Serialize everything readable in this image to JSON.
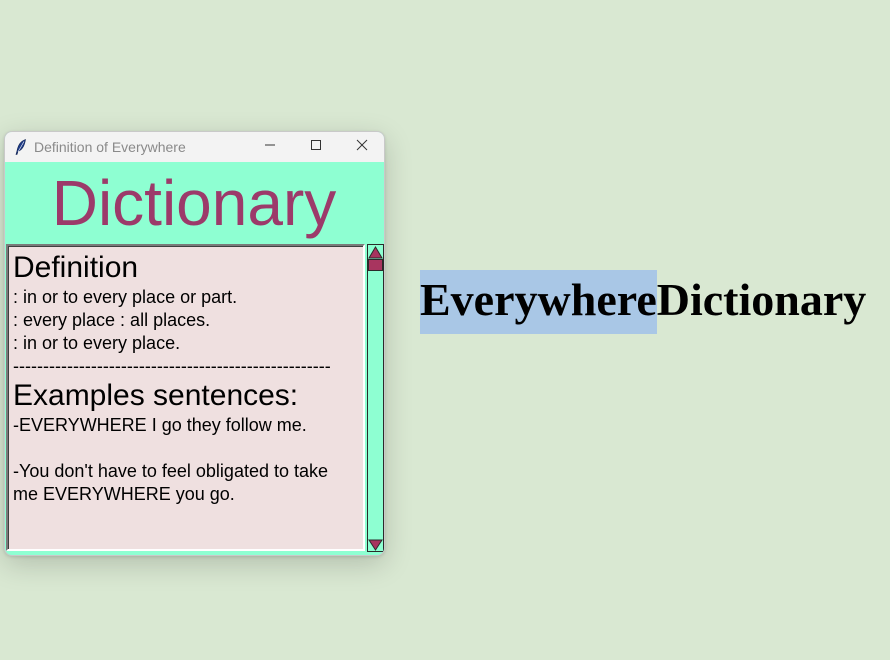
{
  "window": {
    "title": "Definition of Everywhere",
    "icons": {
      "app": "feather-icon",
      "minimize": "minimize-icon",
      "maximize": "maximize-icon",
      "close": "close-icon"
    }
  },
  "app": {
    "heading": "Dictionary",
    "text": {
      "definition_heading": "Definition",
      "definitions": [
        ": in or to every place or part.",
        ": every place : all places.",
        ": in or to every place."
      ],
      "separator": "-----------------------------------------------------",
      "examples_heading": "Examples sentences:",
      "example_1": "-EVERYWHERE I go they follow me.",
      "example_2": "-You don't have to feel obligated to take me EVERYWHERE you go."
    },
    "scrollbar": {
      "up_icon": "scroll-up-arrow-icon",
      "down_icon": "scroll-down-arrow-icon"
    }
  },
  "desktop": {
    "selected_word": "Everywhere",
    "trailing_word": "Dictionary"
  },
  "colors": {
    "background": "#d9e8d2",
    "window_bg": "#8effd2",
    "heading": "#9c3a6a",
    "textarea_bg": "#efe0e0",
    "scroll_accent": "#a8355f",
    "selection": "#a9c7e6"
  }
}
